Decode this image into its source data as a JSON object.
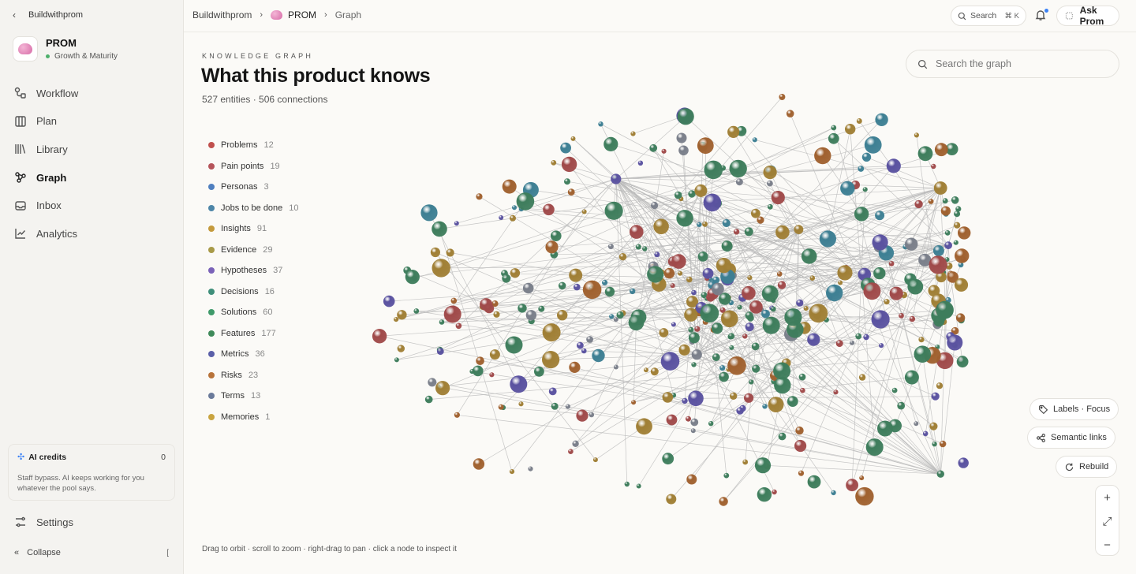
{
  "back": {
    "label": "Buildwithprom"
  },
  "workspace": {
    "name": "PROM",
    "subtitle": "Growth & Maturity"
  },
  "nav": [
    {
      "label": "Workflow",
      "icon": "workflow-icon",
      "active": false
    },
    {
      "label": "Plan",
      "icon": "plan-icon",
      "active": false
    },
    {
      "label": "Library",
      "icon": "library-icon",
      "active": false
    },
    {
      "label": "Graph",
      "icon": "graph-icon",
      "active": true
    },
    {
      "label": "Inbox",
      "icon": "inbox-icon",
      "active": false
    },
    {
      "label": "Analytics",
      "icon": "analytics-icon",
      "active": false
    }
  ],
  "credits": {
    "label": "AI credits",
    "value": "0",
    "note": "Staff bypass. AI keeps working for you whatever the pool says."
  },
  "settings": {
    "label": "Settings"
  },
  "collapse": {
    "label": "Collapse",
    "shortcut": "["
  },
  "breadcrumb": {
    "root": "Buildwithprom",
    "project": "PROM",
    "current": "Graph"
  },
  "topbar": {
    "search_label": "Search",
    "search_shortcut": "⌘ K",
    "ask_label": "Ask Prom",
    "has_notification": true
  },
  "header": {
    "eyebrow": "KNOWLEDGE GRAPH",
    "title": "What this product knows",
    "subtitle": "527 entities · 506 connections"
  },
  "graph_search": {
    "placeholder": "Search the graph"
  },
  "legend": [
    {
      "label": "Problems",
      "count": "12",
      "color": "#c0504d"
    },
    {
      "label": "Pain points",
      "count": "19",
      "color": "#b5545a"
    },
    {
      "label": "Personas",
      "count": "3",
      "color": "#4f7fbf"
    },
    {
      "label": "Jobs to be done",
      "count": "10",
      "color": "#4d86a8"
    },
    {
      "label": "Insights",
      "count": "91",
      "color": "#c49a3c"
    },
    {
      "label": "Evidence",
      "count": "29",
      "color": "#a89a48"
    },
    {
      "label": "Hypotheses",
      "count": "37",
      "color": "#7a62b8"
    },
    {
      "label": "Decisions",
      "count": "16",
      "color": "#3f8f7a"
    },
    {
      "label": "Solutions",
      "count": "60",
      "color": "#3f9a6a"
    },
    {
      "label": "Features",
      "count": "177",
      "color": "#3f8a5a"
    },
    {
      "label": "Metrics",
      "count": "36",
      "color": "#5a5fa8"
    },
    {
      "label": "Risks",
      "count": "23",
      "color": "#b8733a"
    },
    {
      "label": "Terms",
      "count": "13",
      "color": "#6a7a9a"
    },
    {
      "label": "Memories",
      "count": "1",
      "color": "#c9a440"
    }
  ],
  "hint": "Drag to orbit · scroll to zoom · right-drag to pan · click a node to inspect it",
  "controls": {
    "labels": "Labels · Focus",
    "semantic": "Semantic links",
    "rebuild": "Rebuild"
  },
  "zoom": {
    "in": "+",
    "fit": "⤢",
    "out": "−"
  }
}
